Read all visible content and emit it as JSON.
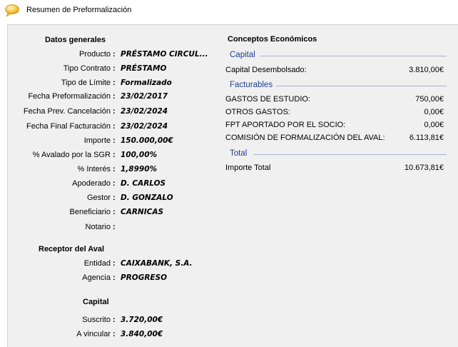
{
  "header": {
    "title": "Resumen de Preformalización",
    "icon": "speech-bubble-icon"
  },
  "general": {
    "title": "Datos generales",
    "rows": [
      {
        "label": "Producto",
        "value": "PRÉSTAMO CIRCUL..."
      },
      {
        "label": "Tipo Contrato",
        "value": "PRÉSTAMO"
      },
      {
        "label": "Tipo de Límite",
        "value": "Formalizado"
      },
      {
        "label": "Fecha Preformalización",
        "value": "23/02/2017"
      },
      {
        "label": "Fecha Prev. Cancelación",
        "value": "23/02/2024"
      },
      {
        "label": "Fecha Final Facturación",
        "value": "23/02/2024"
      },
      {
        "label": "Importe",
        "value": "150.000,00€"
      },
      {
        "label": "% Avalado por la SGR",
        "value": "100,00%"
      },
      {
        "label": "% Interés",
        "value": "1,8990%"
      },
      {
        "label": "Apoderado",
        "value": "D. CARLOS"
      },
      {
        "label": "Gestor",
        "value": "D. GONZALO"
      },
      {
        "label": "Beneficiario",
        "value": "CARNICAS"
      },
      {
        "label": "Notario",
        "value": ""
      }
    ]
  },
  "receptor": {
    "title": "Receptor del Aval",
    "rows": [
      {
        "label": "Entidad",
        "value": "CAIXABANK, S.A."
      },
      {
        "label": "Agencia",
        "value": "PROGRESO"
      }
    ]
  },
  "capital": {
    "title": "Capital",
    "rows": [
      {
        "label": "Suscrito",
        "value": "3.720,00€"
      },
      {
        "label": "A vincular",
        "value": "3.840,00€"
      }
    ]
  },
  "conceptos": {
    "title": "Conceptos Económicos",
    "capital_group": {
      "title": "Capital",
      "rows": [
        {
          "label": "Capital Desembolsado:",
          "value": "3.810,00€"
        }
      ]
    },
    "facturables_group": {
      "title": "Facturables",
      "rows": [
        {
          "label": "GASTOS DE ESTUDIO:",
          "value": "750,00€"
        },
        {
          "label": "OTROS GASTOS:",
          "value": "0,00€"
        },
        {
          "label": "FPT APORTADO POR EL SOCIO:",
          "value": "0,00€"
        },
        {
          "label": "COMISIÓN DE FORMALIZACIÓN DEL AVAL:",
          "value": "6.113,81€"
        }
      ]
    },
    "total_group": {
      "title": "Total",
      "rows": [
        {
          "label": "Importe Total",
          "value": "10.673,81€"
        }
      ]
    }
  }
}
